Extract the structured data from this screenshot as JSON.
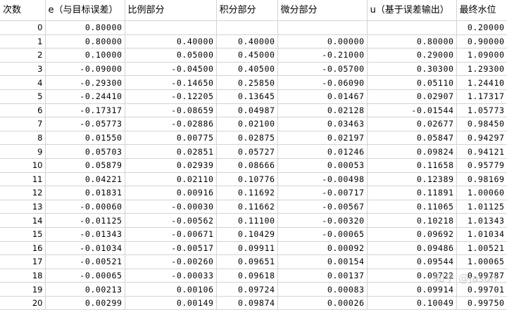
{
  "headers": [
    "次数",
    "e（与目标误差）",
    "比例部分",
    "积分部分",
    "微分部分",
    "u（基于误差输出）",
    "最终水位"
  ],
  "rows": [
    [
      "0",
      "0.80000",
      "",
      "",
      "",
      "",
      "0.20000"
    ],
    [
      "1",
      "0.80000",
      "0.40000",
      "0.40000",
      "0.00000",
      "0.80000",
      "0.90000"
    ],
    [
      "2",
      "0.10000",
      "0.05000",
      "0.45000",
      "-0.21000",
      "0.29000",
      "1.09000"
    ],
    [
      "3",
      "-0.09000",
      "-0.04500",
      "0.40500",
      "-0.05700",
      "0.30300",
      "1.29300"
    ],
    [
      "4",
      "-0.29300",
      "-0.14650",
      "0.25850",
      "-0.06090",
      "0.05110",
      "1.24410"
    ],
    [
      "5",
      "-0.24410",
      "-0.12205",
      "0.13645",
      "0.01467",
      "0.02907",
      "1.17317"
    ],
    [
      "6",
      "-0.17317",
      "-0.08659",
      "0.04987",
      "0.02128",
      "-0.01544",
      "1.05773"
    ],
    [
      "7",
      "-0.05773",
      "-0.02886",
      "0.02100",
      "0.03463",
      "0.02677",
      "0.98450"
    ],
    [
      "8",
      "0.01550",
      "0.00775",
      "0.02875",
      "0.02197",
      "0.05847",
      "0.94297"
    ],
    [
      "9",
      "0.05703",
      "0.02851",
      "0.05727",
      "0.01246",
      "0.09824",
      "0.94121"
    ],
    [
      "10",
      "0.05879",
      "0.02939",
      "0.08666",
      "0.00053",
      "0.11658",
      "0.95779"
    ],
    [
      "11",
      "0.04221",
      "0.02110",
      "0.10776",
      "-0.00498",
      "0.12389",
      "0.98169"
    ],
    [
      "12",
      "0.01831",
      "0.00916",
      "0.11692",
      "-0.00717",
      "0.11891",
      "1.00060"
    ],
    [
      "13",
      "-0.00060",
      "-0.00030",
      "0.11662",
      "-0.00567",
      "0.11065",
      "1.01125"
    ],
    [
      "14",
      "-0.01125",
      "-0.00562",
      "0.11100",
      "-0.00320",
      "0.10218",
      "1.01343"
    ],
    [
      "15",
      "-0.01343",
      "-0.00671",
      "0.10429",
      "-0.00065",
      "0.09692",
      "1.01034"
    ],
    [
      "16",
      "-0.01034",
      "-0.00517",
      "0.09911",
      "0.00092",
      "0.09486",
      "1.00521"
    ],
    [
      "17",
      "-0.00521",
      "-0.00260",
      "0.09651",
      "0.00154",
      "0.09544",
      "1.00065"
    ],
    [
      "18",
      "-0.00065",
      "-0.00033",
      "0.09618",
      "0.00137",
      "0.09722",
      "0.99787"
    ],
    [
      "19",
      "0.00213",
      "0.00106",
      "0.09724",
      "0.00083",
      "0.09914",
      "0.99701"
    ],
    [
      "20",
      "0.00299",
      "0.00149",
      "0.09874",
      "0.00026",
      "0.10049",
      "0.99750"
    ]
  ],
  "watermark": "知乎 @jason"
}
